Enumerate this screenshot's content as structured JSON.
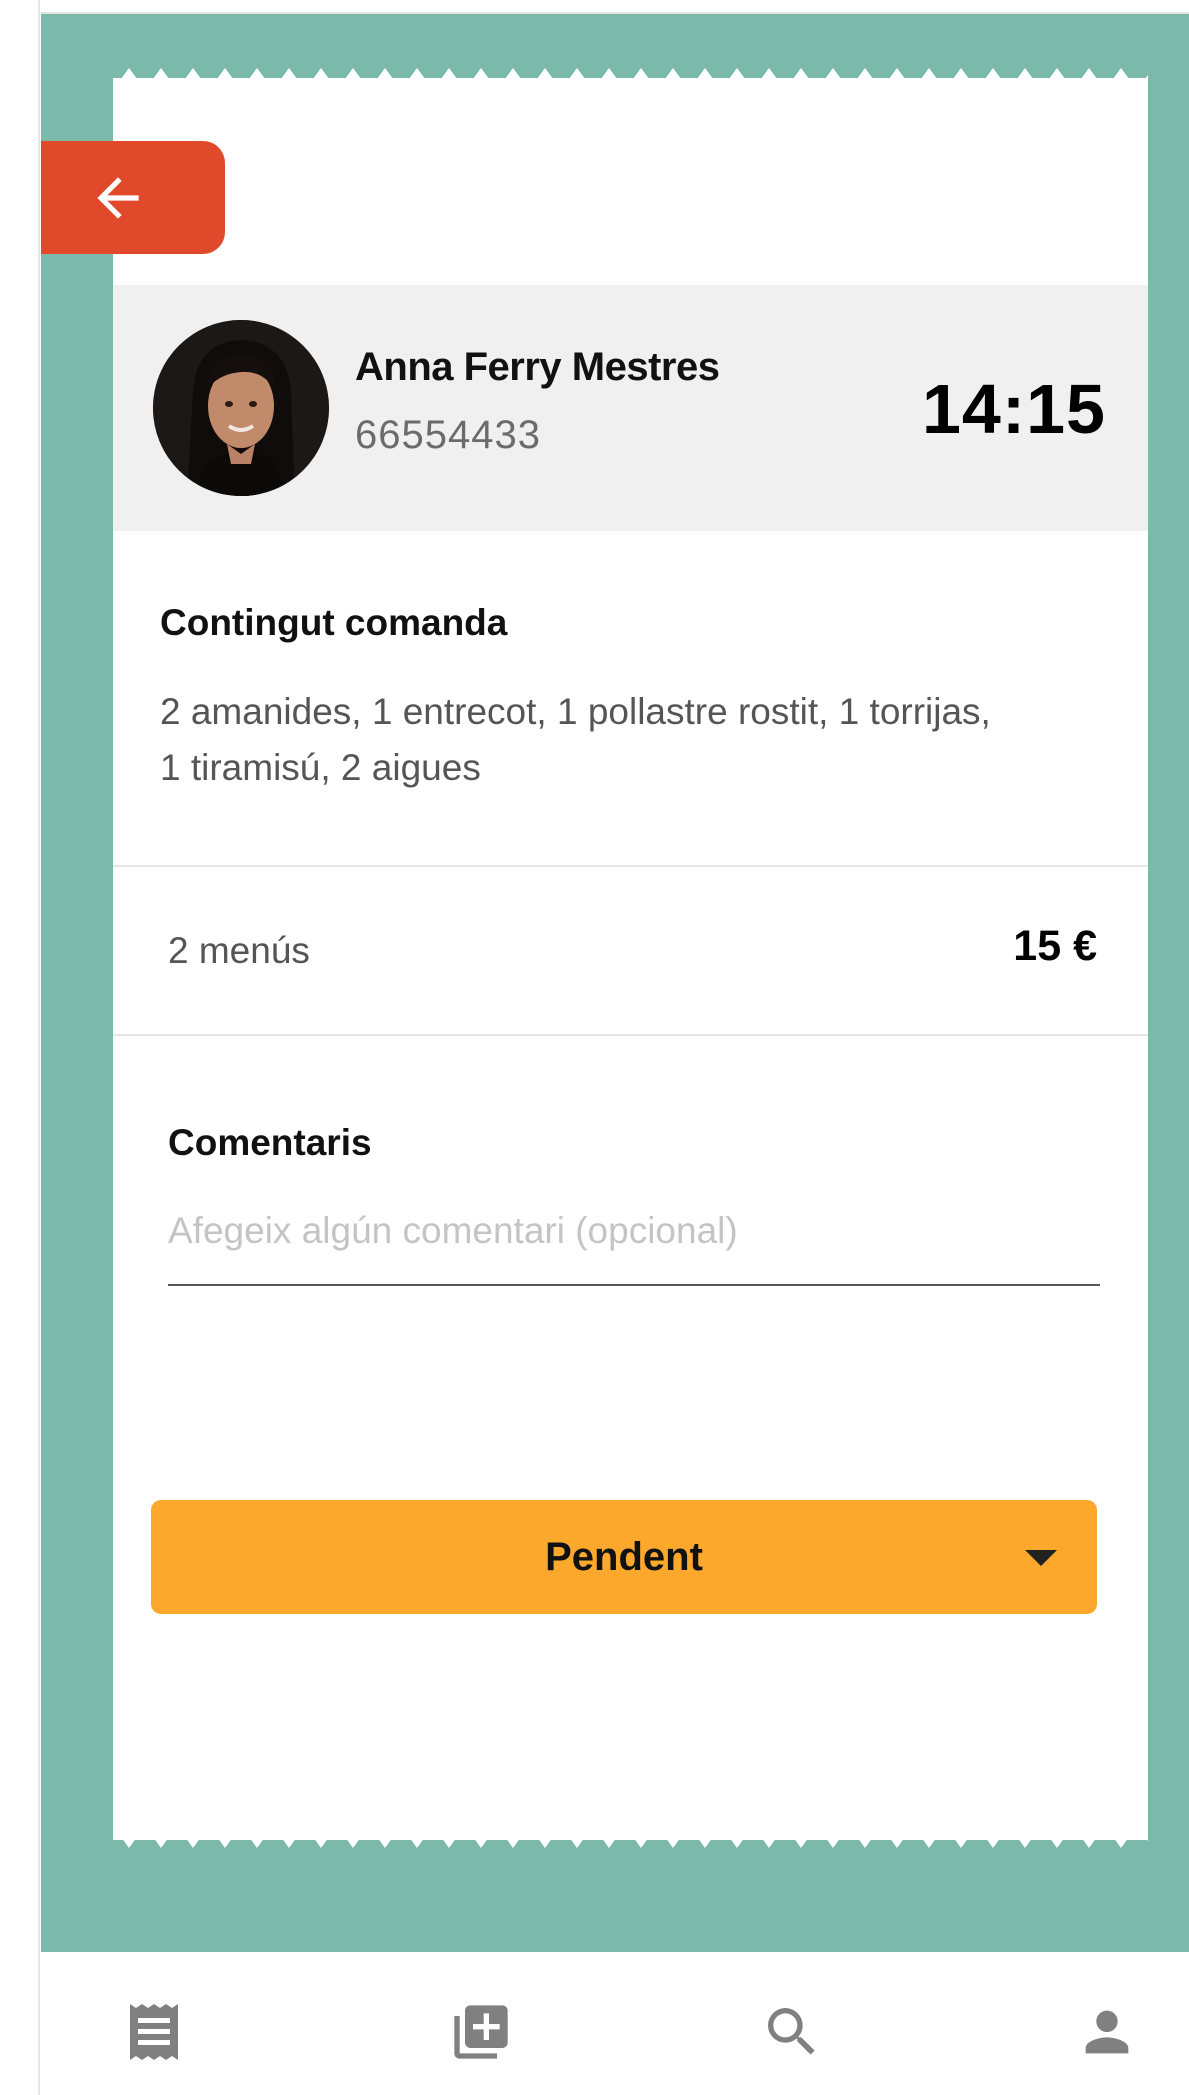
{
  "navigation": {
    "back_icon": "arrow-left-icon"
  },
  "customer": {
    "name": "Anna Ferry Mestres",
    "phone": "66554433",
    "time": "14:15"
  },
  "order": {
    "content_title": "Contingut comanda",
    "content_text": "2 amanides, 1 entrecot, 1 pollastre rostit, 1 torrijas, 1 tiramisú, 2 aigues",
    "menus_label": "2 menús",
    "menus_price": "15 €"
  },
  "comments": {
    "title": "Comentaris",
    "placeholder": "Afegeix algún comentari (opcional)",
    "value": ""
  },
  "status": {
    "selected": "Pendent"
  },
  "bottom_nav": {
    "items": [
      {
        "icon": "receipt-icon"
      },
      {
        "icon": "add-to-library-icon"
      },
      {
        "icon": "search-icon"
      },
      {
        "icon": "person-icon"
      }
    ]
  },
  "colors": {
    "background_teal": "#7bbaab",
    "back_button": "#e0492a",
    "status_button": "#fba82d",
    "customer_bar": "#f0f0f0"
  }
}
